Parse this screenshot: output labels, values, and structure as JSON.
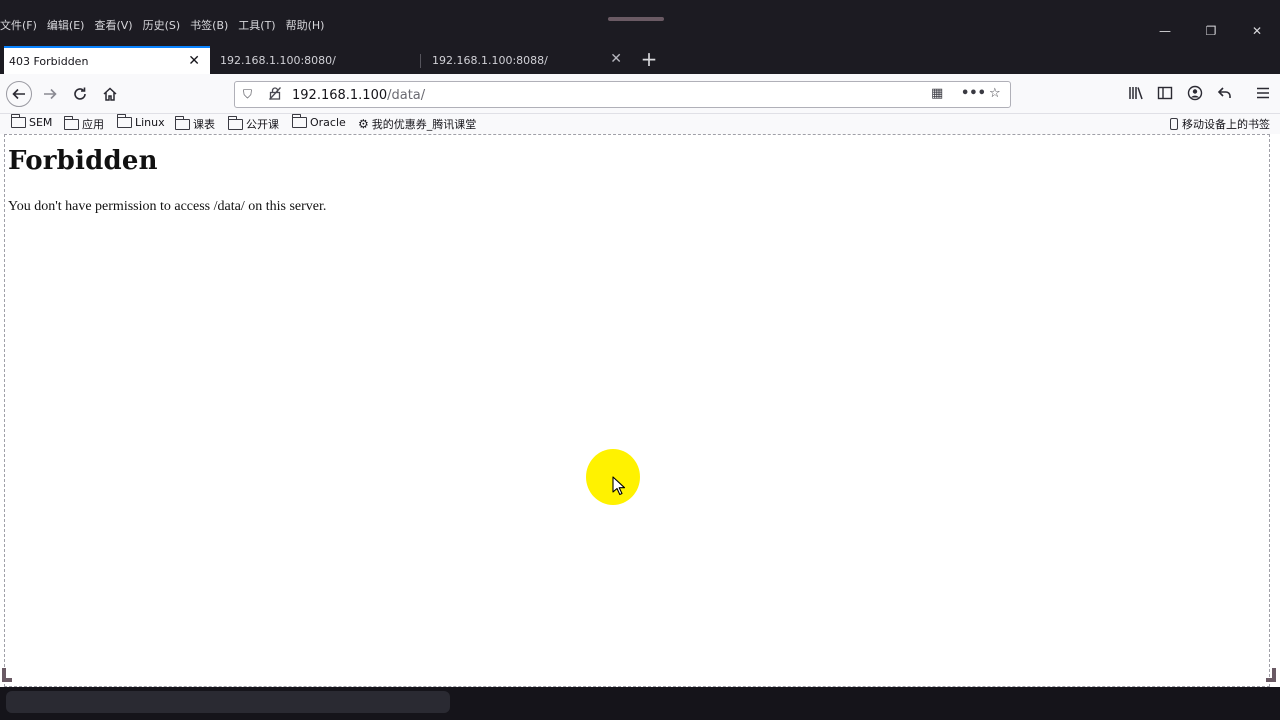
{
  "menubar": {
    "items": [
      "文件(F)",
      "编辑(E)",
      "查看(V)",
      "历史(S)",
      "书签(B)",
      "工具(T)",
      "帮助(H)"
    ]
  },
  "window_controls": {
    "minimize": "—",
    "restore": "❐",
    "close": "✕"
  },
  "tabs": [
    {
      "title": "403 Forbidden",
      "active": true
    },
    {
      "title": "192.168.1.100:8080/",
      "active": false
    },
    {
      "title": "192.168.1.100:8088/",
      "active": false
    }
  ],
  "toolbar": {
    "back_icon": "back-arrow-icon",
    "forward_icon": "forward-arrow-icon",
    "reload_icon": "reload-icon",
    "home_icon": "home-icon"
  },
  "urlbar": {
    "host": "192.168.1.100",
    "path": "/data/"
  },
  "bookmarks": [
    {
      "label": "SEM",
      "icon": "folder-icon"
    },
    {
      "label": "应用",
      "icon": "folder-icon"
    },
    {
      "label": "Linux",
      "icon": "folder-icon"
    },
    {
      "label": "课表",
      "icon": "folder-icon"
    },
    {
      "label": "公开课",
      "icon": "folder-icon"
    },
    {
      "label": "Oracle",
      "icon": "folder-icon"
    },
    {
      "label": "我的优惠券_腾讯课堂",
      "icon": "site-icon"
    }
  ],
  "mobile_bookmarks": "移动设备上的书签",
  "page": {
    "heading": "Forbidden",
    "message": "You don't have permission to access /data/ on this server."
  },
  "colors": {
    "chrome_dark": "#1c1b22",
    "tab_accent": "#0a84ff",
    "cursor_highlight": "#fff200"
  }
}
